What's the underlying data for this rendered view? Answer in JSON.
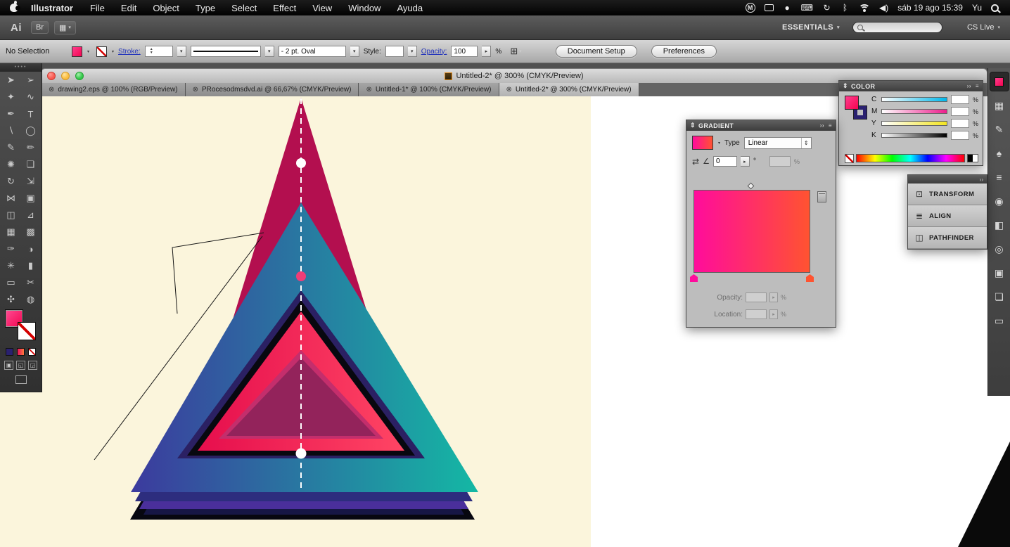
{
  "menu_bar": {
    "app_name": "Illustrator",
    "items": [
      "File",
      "Edit",
      "Object",
      "Type",
      "Select",
      "Effect",
      "View",
      "Window",
      "Ayuda"
    ],
    "status_icons": [
      {
        "name": "m-app",
        "glyph": "M",
        "kind": "circle"
      },
      {
        "name": "battery",
        "glyph": "",
        "kind": "box"
      },
      {
        "name": "record",
        "glyph": "●",
        "kind": "plain"
      },
      {
        "name": "keyboard",
        "glyph": "⌨",
        "kind": "plain"
      },
      {
        "name": "time-machine",
        "glyph": "↻",
        "kind": "plain"
      },
      {
        "name": "bluetooth",
        "glyph": "ᛒ",
        "kind": "plain"
      },
      {
        "name": "wifi",
        "glyph": "",
        "kind": "wifi"
      },
      {
        "name": "volume",
        "glyph": "◀)",
        "kind": "plain"
      }
    ],
    "clock": "sáb 19 ago 15:39",
    "user": "Yu"
  },
  "app_bar": {
    "logo": "Ai",
    "bridge_label": "Br",
    "arrange_icon": "▦",
    "workspace_label": "ESSENTIALS",
    "search_placeholder": "",
    "cs_live_label": "CS Live"
  },
  "control_bar": {
    "selection_status": "No Selection",
    "stroke_label": "Stroke:",
    "stroke_value": "",
    "brush_label": "- 2 pt. Oval",
    "style_label": "Style:",
    "opacity_label": "Opacity:",
    "opacity_value": "100",
    "percent": "%",
    "options_icon": "⊞",
    "document_setup_label": "Document Setup",
    "preferences_label": "Preferences"
  },
  "document_window": {
    "title": "Untitled-2* @ 300% (CMYK/Preview)"
  },
  "tabs": [
    {
      "label": "drawing2.eps @ 100% (RGB/Preview)",
      "active": false
    },
    {
      "label": "PRocesodmsdvd.ai @ 66,67% (CMYK/Preview)",
      "active": false
    },
    {
      "label": "Untitled-1* @ 100% (CMYK/Preview)",
      "active": false
    },
    {
      "label": "Untitled-2* @ 300% (CMYK/Preview)",
      "active": true
    }
  ],
  "toolbar": {
    "tools": [
      {
        "name": "selection",
        "glyph": "➤"
      },
      {
        "name": "direct-selection",
        "glyph": "➢"
      },
      {
        "name": "magic-wand",
        "glyph": "✦"
      },
      {
        "name": "lasso",
        "glyph": "∿"
      },
      {
        "name": "pen",
        "glyph": "✒"
      },
      {
        "name": "type",
        "glyph": "T"
      },
      {
        "name": "line-segment",
        "glyph": "∖"
      },
      {
        "name": "ellipse",
        "glyph": "◯"
      },
      {
        "name": "paintbrush",
        "glyph": "✎"
      },
      {
        "name": "pencil",
        "glyph": "✏"
      },
      {
        "name": "blob-brush",
        "glyph": "✺"
      },
      {
        "name": "eraser",
        "glyph": "❏"
      },
      {
        "name": "rotate",
        "glyph": "↻"
      },
      {
        "name": "scale",
        "glyph": "⇲"
      },
      {
        "name": "width",
        "glyph": "⋈"
      },
      {
        "name": "free-transform",
        "glyph": "▣"
      },
      {
        "name": "shape-builder",
        "glyph": "◫"
      },
      {
        "name": "perspective-grid",
        "glyph": "⊿"
      },
      {
        "name": "mesh",
        "glyph": "▦"
      },
      {
        "name": "gradient",
        "glyph": "▩"
      },
      {
        "name": "eyedropper",
        "glyph": "✑"
      },
      {
        "name": "blend",
        "glyph": "◑"
      },
      {
        "name": "symbol-sprayer",
        "glyph": "✳"
      },
      {
        "name": "column-graph",
        "glyph": "▮"
      },
      {
        "name": "artboard",
        "glyph": "▭"
      },
      {
        "name": "slice",
        "glyph": "✂"
      },
      {
        "name": "hand",
        "glyph": "✣"
      },
      {
        "name": "zoom",
        "glyph": "◍"
      }
    ]
  },
  "color_panel": {
    "title": "COLOR",
    "channels": [
      {
        "label": "C",
        "value": ""
      },
      {
        "label": "M",
        "value": ""
      },
      {
        "label": "Y",
        "value": ""
      },
      {
        "label": "K",
        "value": ""
      }
    ],
    "percent": "%"
  },
  "gradient_panel": {
    "title": "GRADIENT",
    "type_label": "Type",
    "type_value": "Linear",
    "angle_value": "0",
    "degree": "°",
    "opacity_label": "Opacity:",
    "location_label": "Location:",
    "percent": "%"
  },
  "panel_group": {
    "items": [
      {
        "label": "TRANSFORM",
        "icon": "⊡"
      },
      {
        "label": "ALIGN",
        "icon": "≣"
      },
      {
        "label": "PATHFINDER",
        "icon": "◫"
      }
    ]
  },
  "dock": {
    "icons": [
      {
        "name": "color",
        "glyph": "",
        "active": true
      },
      {
        "name": "swatches",
        "glyph": "▦",
        "active": false
      },
      {
        "name": "brushes",
        "glyph": "✎",
        "active": false
      },
      {
        "name": "symbols",
        "glyph": "♠",
        "active": false
      },
      {
        "name": "stroke",
        "glyph": "≡",
        "active": false
      },
      {
        "name": "gradient",
        "glyph": "◉",
        "active": false
      },
      {
        "name": "transparency",
        "glyph": "◧",
        "active": false
      },
      {
        "name": "appearance",
        "glyph": "◎",
        "active": false
      },
      {
        "name": "graphic-styles",
        "glyph": "▣",
        "active": false
      },
      {
        "name": "layers",
        "glyph": "❏",
        "active": false
      },
      {
        "name": "artboards",
        "glyph": "▭",
        "active": false
      }
    ]
  },
  "artwork": {
    "zoom": "300%",
    "palette": {
      "canvas-cream": "#FBF5DC",
      "crimson": "#B30F4F",
      "teal-left": "#3C3A9E",
      "teal-right": "#14B8A4",
      "strip-1": "#2D2D7E",
      "strip-2": "#4A2F9B",
      "strip-3": "#161645",
      "strip-4": "#070710",
      "indigo": "#2B2063",
      "black-tri": "#08080F",
      "pink-left": "#E60E4D",
      "pink-right": "#FF4564",
      "mid-pink": "#C42E6C",
      "dark-rose": "#93235B",
      "dot-pink": "#EF3D77",
      "grad-l": "#FF0C9C",
      "grad-r": "#FF5330",
      "wedge": "#0A0A0A"
    }
  }
}
